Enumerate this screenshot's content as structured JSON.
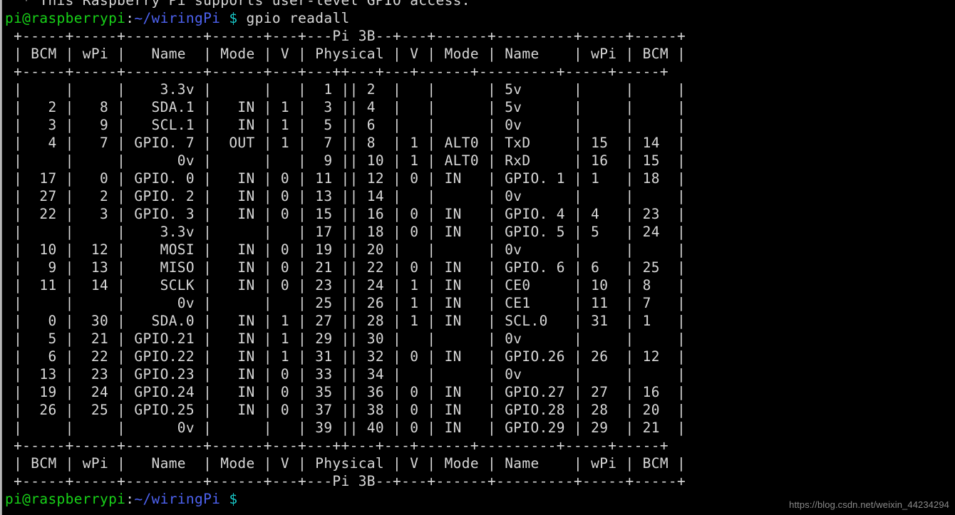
{
  "terminal": {
    "title": "gpio readall",
    "colors": {
      "background": "#000000",
      "foreground": "#d8d8d8",
      "prompt_user_host": "#18d218",
      "prompt_path": "#4d62f0",
      "prompt_symbol": "#18c8c8",
      "watermark": "#8a8a8a"
    },
    "scrollback_top_line": "  * This Raspberry Pi supports user-level GPIO access.",
    "prompt": {
      "user_host": "pi@raspberrypi",
      "separator": ":",
      "path": "~/wiringPi",
      "symbol": "$"
    },
    "command": "gpio readall",
    "watermark": "https://blog.csdn.net/weixin_44234294"
  },
  "table": {
    "board_label": "Pi 3B",
    "rule_top": " +-----+-----+---------+------+---+---Pi 3B--+---+------+---------+-----+-----+",
    "rule_mid": " +-----+-----+---------+------+---+---++---+---+------+---------+-----+-----+",
    "rule_bottom": " +-----+-----+---------+------+---+---++---+---+------+---------+-----+-----+",
    "rule_foot": " +-----+-----+---------+------+---+---Pi 3B--+---+------+---------+-----+-----+",
    "header": " | BCM | wPi |   Name  | Mode | V | Physical | V | Mode | Name    | wPi | BCM |",
    "columns_left": [
      "BCM",
      "wPi",
      "Name",
      "Mode",
      "V",
      "Physical"
    ],
    "columns_right": [
      "V",
      "Mode",
      "Name",
      "wPi",
      "BCM"
    ],
    "rows": [
      {
        "bcm_l": "",
        "wpi_l": "",
        "name_l": "3.3v",
        "mode_l": "",
        "v_l": "",
        "phys_l": "1",
        "phys_r": "2",
        "v_r": "",
        "mode_r": "",
        "name_r": "5v",
        "wpi_r": "",
        "bcm_r": ""
      },
      {
        "bcm_l": "2",
        "wpi_l": "8",
        "name_l": "SDA.1",
        "mode_l": "IN",
        "v_l": "1",
        "phys_l": "3",
        "phys_r": "4",
        "v_r": "",
        "mode_r": "",
        "name_r": "5v",
        "wpi_r": "",
        "bcm_r": ""
      },
      {
        "bcm_l": "3",
        "wpi_l": "9",
        "name_l": "SCL.1",
        "mode_l": "IN",
        "v_l": "1",
        "phys_l": "5",
        "phys_r": "6",
        "v_r": "",
        "mode_r": "",
        "name_r": "0v",
        "wpi_r": "",
        "bcm_r": ""
      },
      {
        "bcm_l": "4",
        "wpi_l": "7",
        "name_l": "GPIO. 7",
        "mode_l": "OUT",
        "v_l": "1",
        "phys_l": "7",
        "phys_r": "8",
        "v_r": "1",
        "mode_r": "ALT0",
        "name_r": "TxD",
        "wpi_r": "15",
        "bcm_r": "14"
      },
      {
        "bcm_l": "",
        "wpi_l": "",
        "name_l": "0v",
        "mode_l": "",
        "v_l": "",
        "phys_l": "9",
        "phys_r": "10",
        "v_r": "1",
        "mode_r": "ALT0",
        "name_r": "RxD",
        "wpi_r": "16",
        "bcm_r": "15"
      },
      {
        "bcm_l": "17",
        "wpi_l": "0",
        "name_l": "GPIO. 0",
        "mode_l": "IN",
        "v_l": "0",
        "phys_l": "11",
        "phys_r": "12",
        "v_r": "0",
        "mode_r": "IN",
        "name_r": "GPIO. 1",
        "wpi_r": "1",
        "bcm_r": "18"
      },
      {
        "bcm_l": "27",
        "wpi_l": "2",
        "name_l": "GPIO. 2",
        "mode_l": "IN",
        "v_l": "0",
        "phys_l": "13",
        "phys_r": "14",
        "v_r": "",
        "mode_r": "",
        "name_r": "0v",
        "wpi_r": "",
        "bcm_r": ""
      },
      {
        "bcm_l": "22",
        "wpi_l": "3",
        "name_l": "GPIO. 3",
        "mode_l": "IN",
        "v_l": "0",
        "phys_l": "15",
        "phys_r": "16",
        "v_r": "0",
        "mode_r": "IN",
        "name_r": "GPIO. 4",
        "wpi_r": "4",
        "bcm_r": "23"
      },
      {
        "bcm_l": "",
        "wpi_l": "",
        "name_l": "3.3v",
        "mode_l": "",
        "v_l": "",
        "phys_l": "17",
        "phys_r": "18",
        "v_r": "0",
        "mode_r": "IN",
        "name_r": "GPIO. 5",
        "wpi_r": "5",
        "bcm_r": "24"
      },
      {
        "bcm_l": "10",
        "wpi_l": "12",
        "name_l": "MOSI",
        "mode_l": "IN",
        "v_l": "0",
        "phys_l": "19",
        "phys_r": "20",
        "v_r": "",
        "mode_r": "",
        "name_r": "0v",
        "wpi_r": "",
        "bcm_r": ""
      },
      {
        "bcm_l": "9",
        "wpi_l": "13",
        "name_l": "MISO",
        "mode_l": "IN",
        "v_l": "0",
        "phys_l": "21",
        "phys_r": "22",
        "v_r": "0",
        "mode_r": "IN",
        "name_r": "GPIO. 6",
        "wpi_r": "6",
        "bcm_r": "25"
      },
      {
        "bcm_l": "11",
        "wpi_l": "14",
        "name_l": "SCLK",
        "mode_l": "IN",
        "v_l": "0",
        "phys_l": "23",
        "phys_r": "24",
        "v_r": "1",
        "mode_r": "IN",
        "name_r": "CE0",
        "wpi_r": "10",
        "bcm_r": "8"
      },
      {
        "bcm_l": "",
        "wpi_l": "",
        "name_l": "0v",
        "mode_l": "",
        "v_l": "",
        "phys_l": "25",
        "phys_r": "26",
        "v_r": "1",
        "mode_r": "IN",
        "name_r": "CE1",
        "wpi_r": "11",
        "bcm_r": "7"
      },
      {
        "bcm_l": "0",
        "wpi_l": "30",
        "name_l": "SDA.0",
        "mode_l": "IN",
        "v_l": "1",
        "phys_l": "27",
        "phys_r": "28",
        "v_r": "1",
        "mode_r": "IN",
        "name_r": "SCL.0",
        "wpi_r": "31",
        "bcm_r": "1"
      },
      {
        "bcm_l": "5",
        "wpi_l": "21",
        "name_l": "GPIO.21",
        "mode_l": "IN",
        "v_l": "1",
        "phys_l": "29",
        "phys_r": "30",
        "v_r": "",
        "mode_r": "",
        "name_r": "0v",
        "wpi_r": "",
        "bcm_r": ""
      },
      {
        "bcm_l": "6",
        "wpi_l": "22",
        "name_l": "GPIO.22",
        "mode_l": "IN",
        "v_l": "1",
        "phys_l": "31",
        "phys_r": "32",
        "v_r": "0",
        "mode_r": "IN",
        "name_r": "GPIO.26",
        "wpi_r": "26",
        "bcm_r": "12"
      },
      {
        "bcm_l": "13",
        "wpi_l": "23",
        "name_l": "GPIO.23",
        "mode_l": "IN",
        "v_l": "0",
        "phys_l": "33",
        "phys_r": "34",
        "v_r": "",
        "mode_r": "",
        "name_r": "0v",
        "wpi_r": "",
        "bcm_r": ""
      },
      {
        "bcm_l": "19",
        "wpi_l": "24",
        "name_l": "GPIO.24",
        "mode_l": "IN",
        "v_l": "0",
        "phys_l": "35",
        "phys_r": "36",
        "v_r": "0",
        "mode_r": "IN",
        "name_r": "GPIO.27",
        "wpi_r": "27",
        "bcm_r": "16"
      },
      {
        "bcm_l": "26",
        "wpi_l": "25",
        "name_l": "GPIO.25",
        "mode_l": "IN",
        "v_l": "0",
        "phys_l": "37",
        "phys_r": "38",
        "v_r": "0",
        "mode_r": "IN",
        "name_r": "GPIO.28",
        "wpi_r": "28",
        "bcm_r": "20"
      },
      {
        "bcm_l": "",
        "wpi_l": "",
        "name_l": "0v",
        "mode_l": "",
        "v_l": "",
        "phys_l": "39",
        "phys_r": "40",
        "v_r": "0",
        "mode_r": "IN",
        "name_r": "GPIO.29",
        "wpi_r": "29",
        "bcm_r": "21"
      }
    ]
  }
}
